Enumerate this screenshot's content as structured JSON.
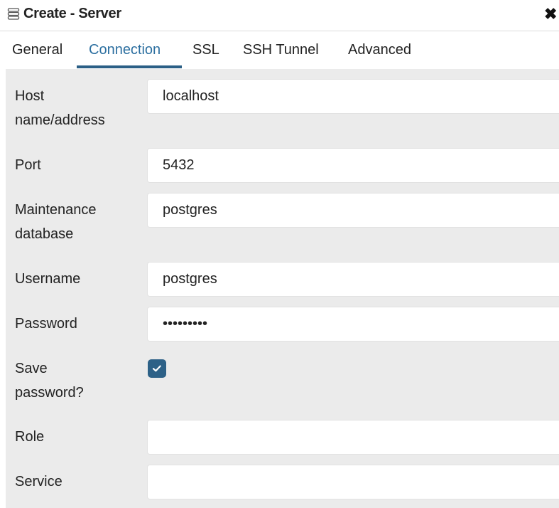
{
  "dialog": {
    "title": "Create - Server",
    "title_icon": "server-icon",
    "close_icon": "close-icon",
    "close_glyph": "✖"
  },
  "tabs": [
    {
      "label": "General",
      "active": false
    },
    {
      "label": "Connection",
      "active": true
    },
    {
      "label": "SSL",
      "active": false
    },
    {
      "label": "SSH Tunnel",
      "active": false
    },
    {
      "label": "Advanced",
      "active": false
    }
  ],
  "form": {
    "host": {
      "label_line1": "Host",
      "label_line2": "name/address",
      "value": "localhost"
    },
    "port": {
      "label": "Port",
      "value": "5432"
    },
    "maintenance_db": {
      "label_line1": "Maintenance",
      "label_line2": "database",
      "value": "postgres"
    },
    "username": {
      "label": "Username",
      "value": "postgres"
    },
    "password": {
      "label": "Password",
      "value": "•••••••••"
    },
    "save_password": {
      "label_line1": "Save",
      "label_line2": "password?",
      "checked": true,
      "icon": "checkmark-icon"
    },
    "role": {
      "label": "Role",
      "value": ""
    },
    "service": {
      "label": "Service",
      "value": ""
    }
  },
  "colors": {
    "active_tab": "#2c6fa0",
    "tab_underline": "#2b5f86",
    "checkbox": "#2d6187",
    "panel_bg": "#ebebeb"
  }
}
